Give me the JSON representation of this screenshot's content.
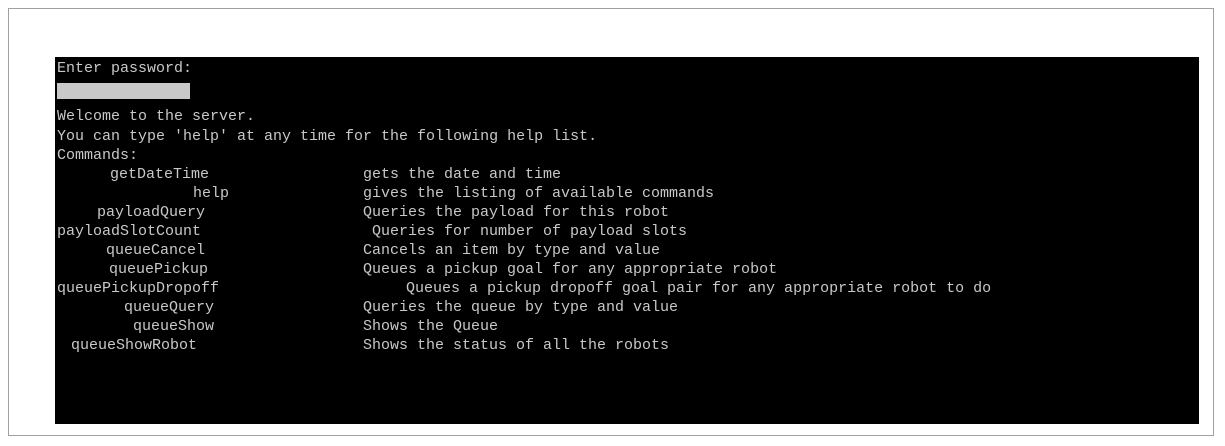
{
  "terminal": {
    "password_prompt": "Enter password:",
    "welcome": "Welcome to the server.",
    "help_hint": "You can type 'help' at any time for the following help list.",
    "commands_header": "Commands:",
    "commands": [
      {
        "name": "getDateTime",
        "description": "gets the date and time"
      },
      {
        "name": "help",
        "description": "gives the listing of available commands"
      },
      {
        "name": "payloadQuery",
        "description": "Queries the payload for this robot"
      },
      {
        "name": "payloadSlotCount",
        "description": "Queries for number of payload slots"
      },
      {
        "name": "queueCancel",
        "description": "Cancels an item by type and value"
      },
      {
        "name": "queuePickup",
        "description": "Queues a pickup goal for any appropriate robot"
      },
      {
        "name": "queuePickupDropoff",
        "description": "Queues a pickup dropoff goal pair for any appropriate robot to do"
      },
      {
        "name": "queueQuery",
        "description": "Queries the queue by type and value"
      },
      {
        "name": "queueShow",
        "description": "Shows the Queue"
      },
      {
        "name": "queueShowRobot",
        "description": "Shows the status of all the robots"
      }
    ]
  },
  "colors": {
    "terminal_bg": "#000000",
    "terminal_text": "#c8c8c8"
  }
}
